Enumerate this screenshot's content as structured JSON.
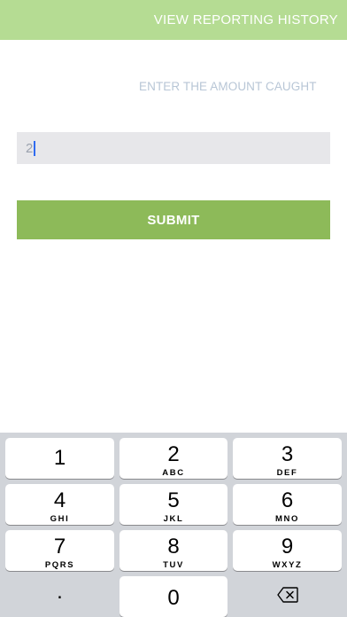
{
  "header": {
    "history_link": "VIEW REPORTING HISTORY"
  },
  "main": {
    "prompt": "ENTER THE AMOUNT CAUGHT",
    "amount_value": "2",
    "submit_label": "SUBMIT"
  },
  "keyboard": {
    "keys": [
      {
        "num": "1",
        "letters": ""
      },
      {
        "num": "2",
        "letters": "ABC"
      },
      {
        "num": "3",
        "letters": "DEF"
      },
      {
        "num": "4",
        "letters": "GHI"
      },
      {
        "num": "5",
        "letters": "JKL"
      },
      {
        "num": "6",
        "letters": "MNO"
      },
      {
        "num": "7",
        "letters": "PQRS"
      },
      {
        "num": "8",
        "letters": "TUV"
      },
      {
        "num": "9",
        "letters": "WXYZ"
      },
      {
        "num": "0",
        "letters": ""
      }
    ],
    "decimal": ".",
    "backspace_icon": "backspace-icon"
  },
  "colors": {
    "topbar": "#b5dc93",
    "submit": "#8dba59",
    "input_bg": "#e7e7ea",
    "caret": "#2f6bf0",
    "keyboard_bg": "#d1d4d9"
  }
}
